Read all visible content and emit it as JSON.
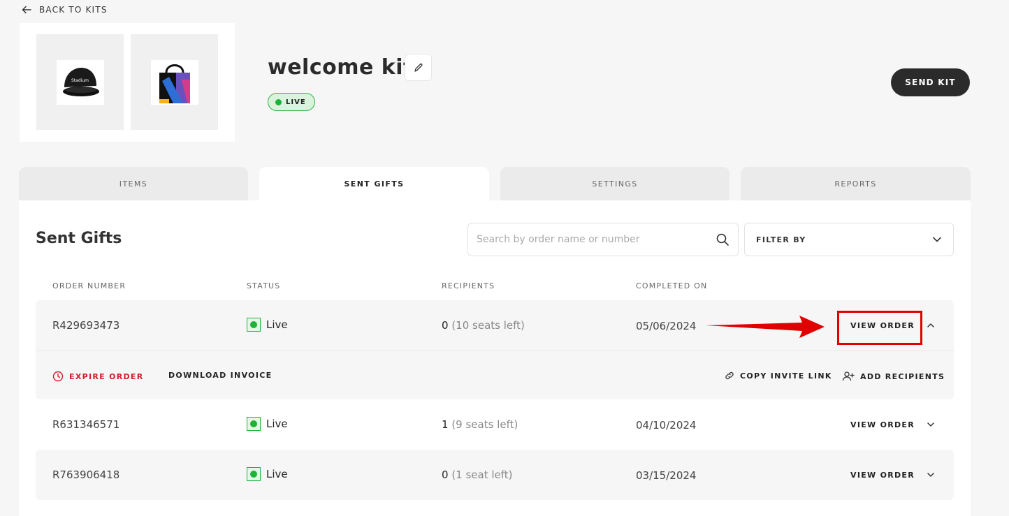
{
  "back": {
    "label": "BACK TO KITS"
  },
  "kit": {
    "title": "welcome kit",
    "status_badge": "LIVE",
    "send_label": "SEND KIT",
    "images": [
      {
        "name": "cap",
        "brand_text": "Stadium"
      },
      {
        "name": "tote-bag"
      }
    ]
  },
  "tabs": [
    {
      "label": "ITEMS",
      "active": false
    },
    {
      "label": "SENT GIFTS",
      "active": true
    },
    {
      "label": "SETTINGS",
      "active": false
    },
    {
      "label": "REPORTS",
      "active": false
    }
  ],
  "sent_gifts": {
    "title": "Sent Gifts",
    "search_placeholder": "Search by order name or number",
    "filter_label": "FILTER BY",
    "columns": [
      "ORDER NUMBER",
      "STATUS",
      "RECIPIENTS",
      "COMPLETED ON"
    ],
    "rows": [
      {
        "order": "R429693473",
        "status": "Live",
        "recipients": "0",
        "seats": "(10 seats left)",
        "completed": "05/06/2024",
        "action": "VIEW ORDER",
        "expanded": true
      },
      {
        "order": "R631346571",
        "status": "Live",
        "recipients": "1",
        "seats": "(9 seats left)",
        "completed": "04/10/2024",
        "action": "VIEW ORDER",
        "expanded": false
      },
      {
        "order": "R763906418",
        "status": "Live",
        "recipients": "0",
        "seats": "(1 seat left)",
        "completed": "03/15/2024",
        "action": "VIEW ORDER",
        "expanded": false
      }
    ],
    "expanded_actions": {
      "expire": "EXPIRE ORDER",
      "download": "DOWNLOAD INVOICE",
      "copy_link": "COPY INVITE LINK",
      "add_recipients": "ADD RECIPIENTS"
    }
  },
  "colors": {
    "accent_dark": "#2b2b2b",
    "live_green": "#1db33a",
    "danger_red": "#d0202e",
    "annotation_red": "#e00000"
  }
}
